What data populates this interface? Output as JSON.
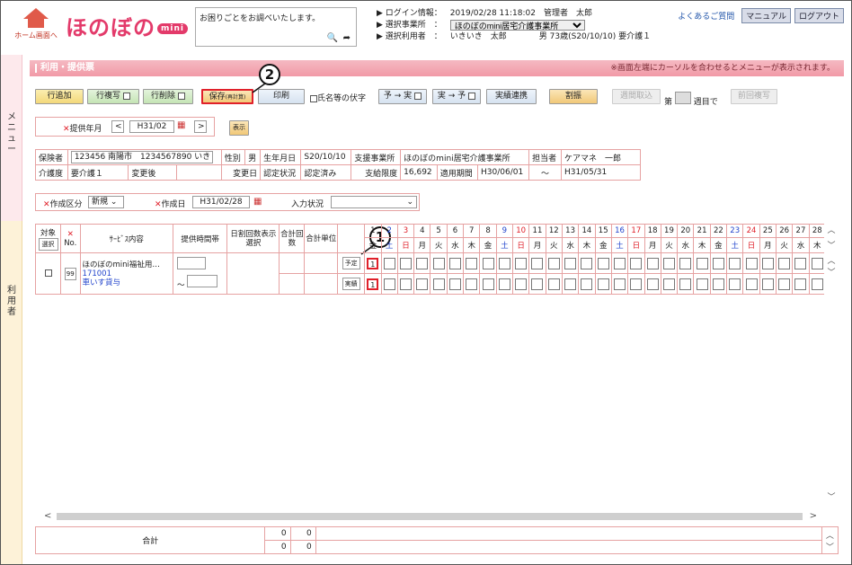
{
  "header": {
    "home_label": "ホーム画面へ",
    "logo_text": "ほのぼの",
    "logo_badge": "mini",
    "help_placeholder": "お困りごとをお調べいたします。",
    "login_label": "ログイン情報：",
    "login_value": "2019/02/28 11:18:02　管理者　太郎",
    "office_label": "選択事業所　：",
    "office_value": "ほのぼのmini居宅介護事業所",
    "user_label": "選択利用者　：",
    "user_value": "いきいき　太郎　　　　男 73歳(S20/10/10) 要介護１",
    "faq_link": "よくあるご質問",
    "manual_button": "マニュアル",
    "logout_button": "ログアウト"
  },
  "side": {
    "menu_label": "メニュー",
    "user_label": "利用者"
  },
  "title": {
    "text": "利用・提供票",
    "note": "※画面左端にカーソルを合わせるとメニューが表示されます。"
  },
  "toolbar": {
    "row_add": "行追加",
    "row_copy": "行複写",
    "row_delete": "行削除",
    "save": "保存",
    "save_sub": "(再計算)",
    "print": "印刷",
    "name_chk": "氏名等の伏字",
    "plan_to_actual": "予 → 実",
    "actual_to_plan": "実 → 予",
    "actual_link": "実績連携",
    "allocate": "割振",
    "weekly_fetch": "週間取込",
    "week_pre": "第",
    "week_post": "週目で",
    "prev_copy": "前回複写"
  },
  "callouts": {
    "one": "1",
    "two": "2"
  },
  "period": {
    "label": "提供年月",
    "value": "H31/02",
    "show": "表示"
  },
  "info": {
    "insurer_label": "保険者",
    "insurer_value": "123456 南陽市　1234567890 いき",
    "gender_label": "性別",
    "gender_value": "男",
    "dob_label": "生年月日",
    "dob_value": "S20/10/10",
    "support_label": "支援事業所",
    "support_value": "ほのぼのmini居宅介護事業所",
    "manager_label": "担当者",
    "manager_value": "ケアマネ　一郎",
    "care_label": "介護度",
    "care_value": "要介護１",
    "changed_label": "変更後",
    "changed_value": "",
    "change_date_label": "変更日",
    "change_date_value": "",
    "cert_label": "認定状況",
    "cert_value": "認定済み",
    "limit_label": "支給限度",
    "limit_value": "16,692",
    "period_label": "適用期間",
    "period_from": "H30/06/01",
    "period_tilde": "〜",
    "period_to": "H31/05/31"
  },
  "make": {
    "kubun_label": "作成区分",
    "kubun_value": "新規",
    "date_label": "作成日",
    "date_value": "H31/02/28",
    "input_label": "入力状況"
  },
  "grid": {
    "col_target": "対象",
    "col_select": "選択",
    "col_no": "No.",
    "col_service": "ｻｰﾋﾞｽ内容",
    "col_time": "提供時間帯",
    "col_daily": "日割回数表示選択",
    "col_total": "合計回数",
    "col_unit": "合計単位",
    "days": [
      "1",
      "2",
      "3",
      "4",
      "5",
      "6",
      "7",
      "8",
      "9",
      "10",
      "11",
      "12",
      "13",
      "14",
      "15",
      "16",
      "17",
      "18",
      "19",
      "20",
      "21",
      "22",
      "23",
      "24",
      "25",
      "26",
      "27",
      "28"
    ],
    "weekdays": [
      "金",
      "土",
      "日",
      "月",
      "火",
      "水",
      "木",
      "金",
      "土",
      "日",
      "月",
      "火",
      "水",
      "木",
      "金",
      "土",
      "日",
      "月",
      "火",
      "水",
      "木",
      "金",
      "土",
      "日",
      "月",
      "火",
      "水",
      "木"
    ],
    "row": {
      "no": "99",
      "service_name": "ほのぼのmini福祉用…",
      "service_code": "171001",
      "service_item": "車いす貸与",
      "time_tilde": "〜",
      "plan_label": "予定",
      "actual_label": "実績",
      "plan_day1": "1",
      "actual_day1": "1"
    }
  },
  "sum": {
    "label": "合計",
    "r1a": "0",
    "r1b": "0",
    "r2a": "0",
    "r2b": "0"
  },
  "colors": {
    "accent": "#f19aa7",
    "border": "#e6a2a2",
    "red": "#e0202a"
  }
}
